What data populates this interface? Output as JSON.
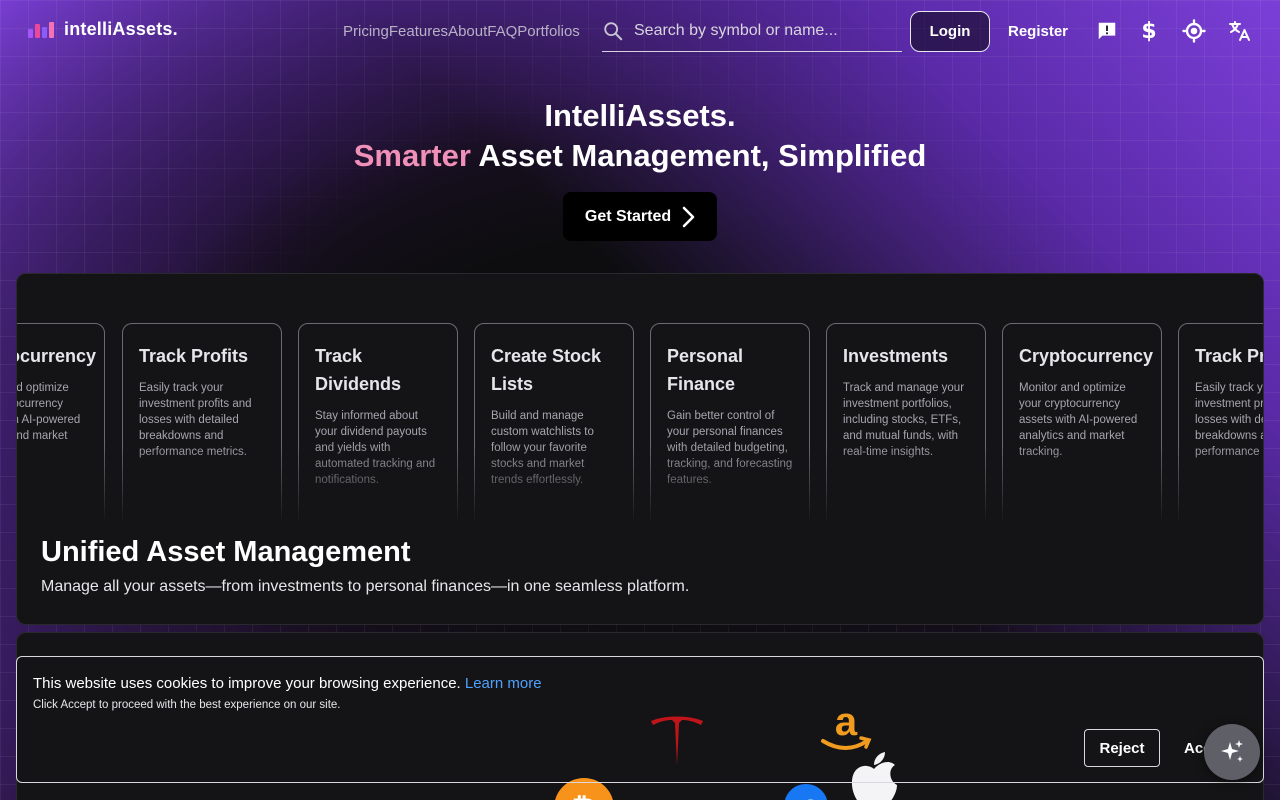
{
  "header": {
    "logo_text": "intelliAssets.",
    "nav": [
      "Pricing",
      "Features",
      "About",
      "FAQ",
      "Portfolios"
    ],
    "search_placeholder": "Search by symbol or name...",
    "login_label": "Login",
    "register_label": "Register",
    "icons": [
      "feedback-icon",
      "currency-icon",
      "theme-toggle-icon",
      "translate-icon"
    ]
  },
  "hero": {
    "title": "IntelliAssets.",
    "subtitle_highlight": "Smarter",
    "subtitle_rest": " Asset Management, Simplified",
    "cta_label": "Get Started"
  },
  "features": [
    {
      "title": "Cryptocurrency",
      "text": "Monitor and optimize your cryptocurrency assets with AI-powered analytics and market tracking."
    },
    {
      "title": "Track Profits",
      "text": "Easily track your investment profits and losses with detailed breakdowns and performance metrics."
    },
    {
      "title": "Track Dividends",
      "text": "Stay informed about your dividend payouts and yields with automated tracking and notifications."
    },
    {
      "title": "Create Stock Lists",
      "text": "Build and manage custom watchlists to follow your favorite stocks and market trends effortlessly."
    },
    {
      "title": "Personal Finance",
      "text": "Gain better control of your personal finances with detailed budgeting, tracking, and forecasting features."
    },
    {
      "title": "Investments",
      "text": "Track and manage your investment portfolios, including stocks, ETFs, and mutual funds, with real-time insights."
    },
    {
      "title": "Cryptocurrency",
      "text": "Monitor and optimize your cryptocurrency assets with AI-powered analytics and market tracking."
    },
    {
      "title": "Track Profits",
      "text": "Easily track your investment profits and losses with detailed breakdowns and performance metrics."
    }
  ],
  "section": {
    "title": "Unified Asset Management",
    "description": "Manage all your assets—from investments to personal finances—in one seamless platform."
  },
  "cookie": {
    "message": "This website uses cookies to improve your browsing experience.",
    "learn_more": "Learn more",
    "note": "Click Accept to proceed with the best experience on our site.",
    "reject_label": "Reject",
    "accept_label": "Accept"
  },
  "colors": {
    "accent_pink": "#f08fb8",
    "link_blue": "#4ea1ff",
    "purple": "#7b3fd8"
  }
}
